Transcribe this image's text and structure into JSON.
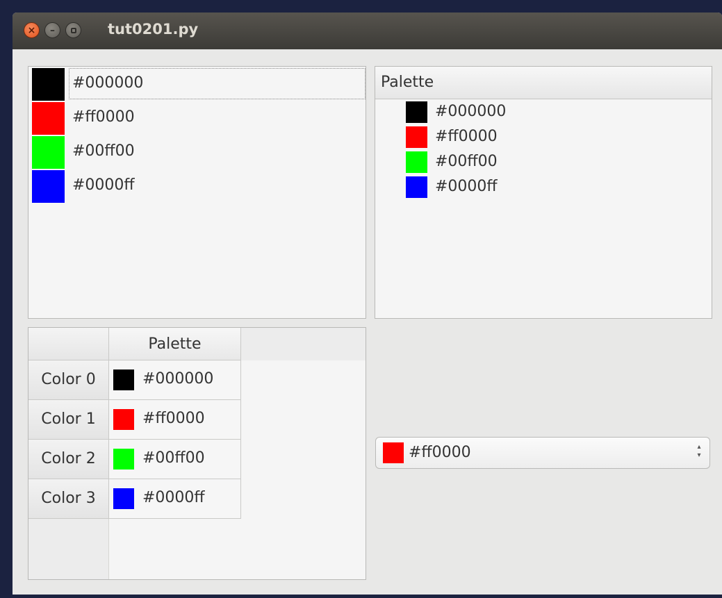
{
  "window": {
    "title": "tut0201.py"
  },
  "colors": {
    "black": "#000000",
    "red": "#ff0000",
    "green": "#00ff00",
    "blue": "#0000ff"
  },
  "list_view": {
    "items": [
      {
        "label": "#000000",
        "color": "#000000"
      },
      {
        "label": "#ff0000",
        "color": "#ff0000"
      },
      {
        "label": "#00ff00",
        "color": "#00ff00"
      },
      {
        "label": "#0000ff",
        "color": "#0000ff"
      }
    ]
  },
  "tree_view": {
    "header": "Palette",
    "items": [
      {
        "label": "#000000",
        "color": "#000000"
      },
      {
        "label": "#ff0000",
        "color": "#ff0000"
      },
      {
        "label": "#00ff00",
        "color": "#00ff00"
      },
      {
        "label": "#0000ff",
        "color": "#0000ff"
      }
    ]
  },
  "table_view": {
    "column_header": "Palette",
    "rows": [
      {
        "header": "Color 0",
        "label": "#000000",
        "color": "#000000"
      },
      {
        "header": "Color 1",
        "label": "#ff0000",
        "color": "#ff0000"
      },
      {
        "header": "Color 2",
        "label": "#00ff00",
        "color": "#00ff00"
      },
      {
        "header": "Color 3",
        "label": "#0000ff",
        "color": "#0000ff"
      }
    ]
  },
  "combo_box": {
    "selected_label": "#ff0000",
    "selected_color": "#ff0000"
  }
}
